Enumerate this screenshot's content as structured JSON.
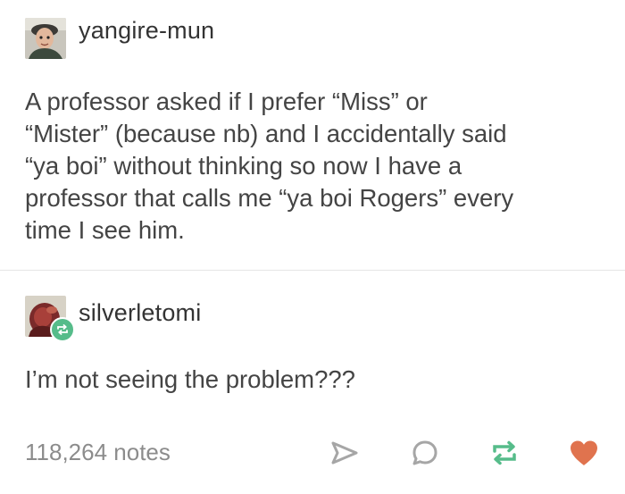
{
  "posts": [
    {
      "username": "yangire-mun",
      "body": "A professor asked if I prefer “Miss” or\n“Mister” (because nb) and I accidentally said\n“ya boi” without thinking so now I have a\nprofessor that calls me “ya boi Rogers” every\ntime I see him.",
      "avatar_icon": "user-avatar"
    },
    {
      "username": "silverletomi",
      "body": "I’m not seeing the problem???",
      "avatar_icon": "user-avatar",
      "badge_icon": "reblog-icon"
    }
  ],
  "footer": {
    "notes": "118,264 notes",
    "actions": [
      "share-icon",
      "reply-icon",
      "reblog-icon",
      "heart-icon"
    ]
  },
  "colors": {
    "reblog_green": "#56bc8a",
    "like_red": "#e0734e",
    "icon_gray": "#a6a6a6",
    "text": "#444444",
    "notes_gray": "#8c8c8c"
  }
}
